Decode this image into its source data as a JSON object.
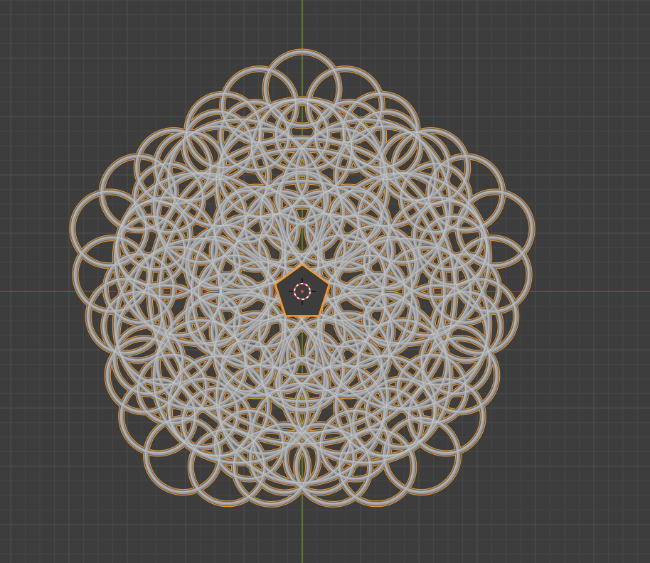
{
  "viewport": {
    "background_color": "#3d3d3d",
    "grid_minor_color": "#464646",
    "grid_major_color": "#4f4f4f",
    "x_axis_color": "#9a3a47",
    "y_axis_color": "#6a8b24",
    "view": "front-orthographic"
  },
  "object": {
    "kind": "wireframe-mesh",
    "shape": "pentagonal-lattice-ornament",
    "symmetry_order": 5,
    "selected": true,
    "mesh_color": "#9b9b9b",
    "shadow_color": "#5e5e5e",
    "highlight_color": "#c7c7c7",
    "selection_outline_color": "#f39a2c",
    "center_hole_color": "#3d3d3d"
  },
  "origin": {
    "selected": true,
    "outer_color": "#ffffff",
    "inner_color": "#e04848"
  }
}
